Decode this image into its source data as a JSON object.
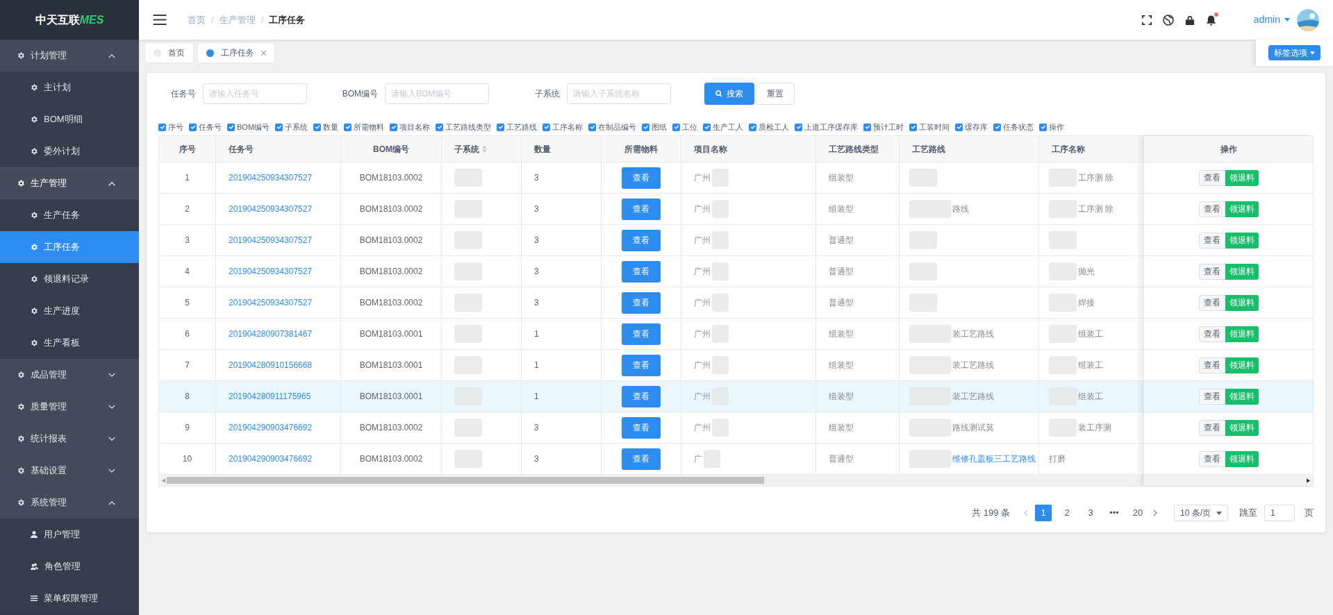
{
  "logo": {
    "text": "中天互联",
    "accent": "MES"
  },
  "sidebar": {
    "items": [
      {
        "label": "计划管理",
        "expanded": true,
        "selected": false,
        "children": [
          {
            "label": "主计划",
            "selected": false
          },
          {
            "label": "BOM明细",
            "selected": false
          },
          {
            "label": "委外计划",
            "selected": false
          }
        ]
      },
      {
        "label": "生产管理",
        "expanded": true,
        "selected": true,
        "children": [
          {
            "label": "生产任务",
            "selected": false
          },
          {
            "label": "工序任务",
            "selected": true
          },
          {
            "label": "领退料记录",
            "selected": false
          },
          {
            "label": "生产进度",
            "selected": false
          },
          {
            "label": "生产看板",
            "selected": false
          }
        ]
      },
      {
        "label": "成品管理",
        "expanded": false,
        "selected": false
      },
      {
        "label": "质量管理",
        "expanded": false,
        "selected": false
      },
      {
        "label": "统计报表",
        "expanded": false,
        "selected": false
      },
      {
        "label": "基础设置",
        "expanded": false,
        "selected": false
      },
      {
        "label": "系统管理",
        "expanded": true,
        "selected": false,
        "children": [
          {
            "label": "用户管理",
            "selected": false
          },
          {
            "label": "角色管理",
            "selected": false
          },
          {
            "label": "菜单权限管理",
            "selected": false
          }
        ]
      }
    ]
  },
  "breadcrumb": [
    {
      "label": "首页"
    },
    {
      "separator": "/",
      "label": "生产管理"
    },
    {
      "separator": "/",
      "label": "工序任务"
    }
  ],
  "header": {
    "user": "admin",
    "has_notification": true
  },
  "tabs": [
    {
      "label": "首页",
      "selected": false,
      "closable": false
    },
    {
      "label": "工序任务",
      "selected": true,
      "closable": true
    }
  ],
  "tab_options": "标签选项",
  "filters": [
    {
      "label": "任务号",
      "placeholder": "请输入任务号"
    },
    {
      "label": "BOM编号",
      "placeholder": "请输入BOM编号"
    },
    {
      "label": "子系统",
      "placeholder": "请输入子系统名称"
    }
  ],
  "search_button": "搜索",
  "reset_button": "重置",
  "column_toggles": [
    {
      "label": "序号",
      "checked": true
    },
    {
      "label": "任务号",
      "checked": true
    },
    {
      "label": "BOM编号",
      "checked": true
    },
    {
      "label": "子系统",
      "checked": true
    },
    {
      "label": "数量",
      "checked": true
    },
    {
      "label": "所需物料",
      "checked": true
    },
    {
      "label": "项目名称",
      "checked": true
    },
    {
      "label": "工艺路线类型",
      "checked": true
    },
    {
      "label": "工艺路线",
      "checked": true
    },
    {
      "label": "工序名称",
      "checked": true
    },
    {
      "label": "在制品编号",
      "checked": true
    },
    {
      "label": "图纸",
      "checked": true
    },
    {
      "label": "工位",
      "checked": true
    },
    {
      "label": "生产工人",
      "checked": true
    },
    {
      "label": "质检工人",
      "checked": true
    },
    {
      "label": "上道工序缓存库",
      "checked": true
    },
    {
      "label": "预计工时",
      "checked": true
    },
    {
      "label": "工装时间",
      "checked": true
    },
    {
      "label": "缓存库",
      "checked": true
    },
    {
      "label": "任务状态",
      "checked": true
    },
    {
      "label": "操作",
      "checked": true
    }
  ],
  "table": {
    "columns": [
      {
        "label": "序号",
        "sortable": false
      },
      {
        "label": "任务号",
        "sortable": false
      },
      {
        "label": "BOM编号",
        "sortable": false
      },
      {
        "label": "子系统",
        "sortable": true
      },
      {
        "label": "数量",
        "sortable": false
      },
      {
        "label": "所需物料",
        "sortable": false
      },
      {
        "label": "项目名称",
        "sortable": false
      },
      {
        "label": "工艺路线类型",
        "sortable": false
      },
      {
        "label": "工艺路线",
        "sortable": false
      },
      {
        "label": "工序名称",
        "sortable": false
      },
      {
        "label": "操作",
        "sortable": false
      }
    ],
    "rows": [
      {
        "no": "1",
        "task": "201904250934307527",
        "bom": "BOM18103.0002",
        "qty": "3",
        "material": "查看",
        "project": "广州",
        "route_type": "组装型",
        "route": "",
        "process": "工序测 除",
        "actions": [
          "查看",
          "领退料"
        ],
        "highlighted": false
      },
      {
        "no": "2",
        "task": "201904250934307527",
        "bom": "BOM18103.0002",
        "qty": "3",
        "material": "查看",
        "project": "广州",
        "route_type": "组装型",
        "route": "路线",
        "process": "工序测 除",
        "actions": [
          "查看",
          "领退料"
        ],
        "highlighted": false
      },
      {
        "no": "3",
        "task": "201904250934307527",
        "bom": "BOM18103.0002",
        "qty": "3",
        "material": "查看",
        "project": "广州",
        "route_type": "普通型",
        "route": "",
        "process": "",
        "actions": [
          "查看",
          "领退料"
        ],
        "highlighted": false
      },
      {
        "no": "4",
        "task": "201904250934307527",
        "bom": "BOM18103.0002",
        "qty": "3",
        "material": "查看",
        "project": "广州",
        "route_type": "普通型",
        "route": "",
        "process": "抛光",
        "actions": [
          "查看",
          "领退料"
        ],
        "highlighted": false
      },
      {
        "no": "5",
        "task": "201904250934307527",
        "bom": "BOM18103.0002",
        "qty": "3",
        "material": "查看",
        "project": "广州",
        "route_type": "普通型",
        "route": "",
        "process": "焊接",
        "actions": [
          "查看",
          "领退料"
        ],
        "highlighted": false
      },
      {
        "no": "6",
        "task": "201904280907381467",
        "bom": "BOM18103.0001",
        "qty": "1",
        "material": "查看",
        "project": "广州",
        "route_type": "组装型",
        "route": "装工艺路线",
        "process": "组装工",
        "actions": [
          "查看",
          "领退料"
        ],
        "highlighted": false
      },
      {
        "no": "7",
        "task": "201904280910156668",
        "bom": "BOM18103.0001",
        "qty": "1",
        "material": "查看",
        "project": "广州",
        "route_type": "组装型",
        "route": "装工艺路线",
        "process": "组装工",
        "actions": [
          "查看",
          "领退料"
        ],
        "highlighted": false
      },
      {
        "no": "8",
        "task": "201904280911175965",
        "bom": "BOM18103.0001",
        "qty": "1",
        "material": "查看",
        "project": "广州",
        "route_type": "组装型",
        "route": "装工艺路线",
        "process": "组装工",
        "actions": [
          "查看",
          "领退料"
        ],
        "highlighted": true
      },
      {
        "no": "9",
        "task": "201904290903476692",
        "bom": "BOM18103.0002",
        "qty": "3",
        "material": "查看",
        "project": "广州",
        "route_type": "组装型",
        "route": "路线测试莫",
        "process": "装工序测",
        "actions": [
          "查看",
          "领退料"
        ],
        "highlighted": false
      },
      {
        "no": "10",
        "task": "201904290903476692",
        "bom": "BOM18103.0002",
        "qty": "3",
        "material": "查看",
        "project": "广",
        "route_type": "普通型",
        "route": "维修孔盖板三工艺路线",
        "process": "打磨",
        "actions": [
          "查看",
          "领退料"
        ],
        "highlighted": false
      }
    ]
  },
  "pagination": {
    "total": "共 199 条",
    "pages": [
      {
        "label": "1",
        "selected": true
      },
      {
        "label": "2",
        "selected": false
      },
      {
        "label": "3",
        "selected": false
      },
      {
        "label": "•••",
        "selected": false
      },
      {
        "label": "20",
        "selected": false
      }
    ],
    "page_size": "10 条/页",
    "jump_label": "跳至",
    "jump_value": "1",
    "page_suffix": "页"
  }
}
